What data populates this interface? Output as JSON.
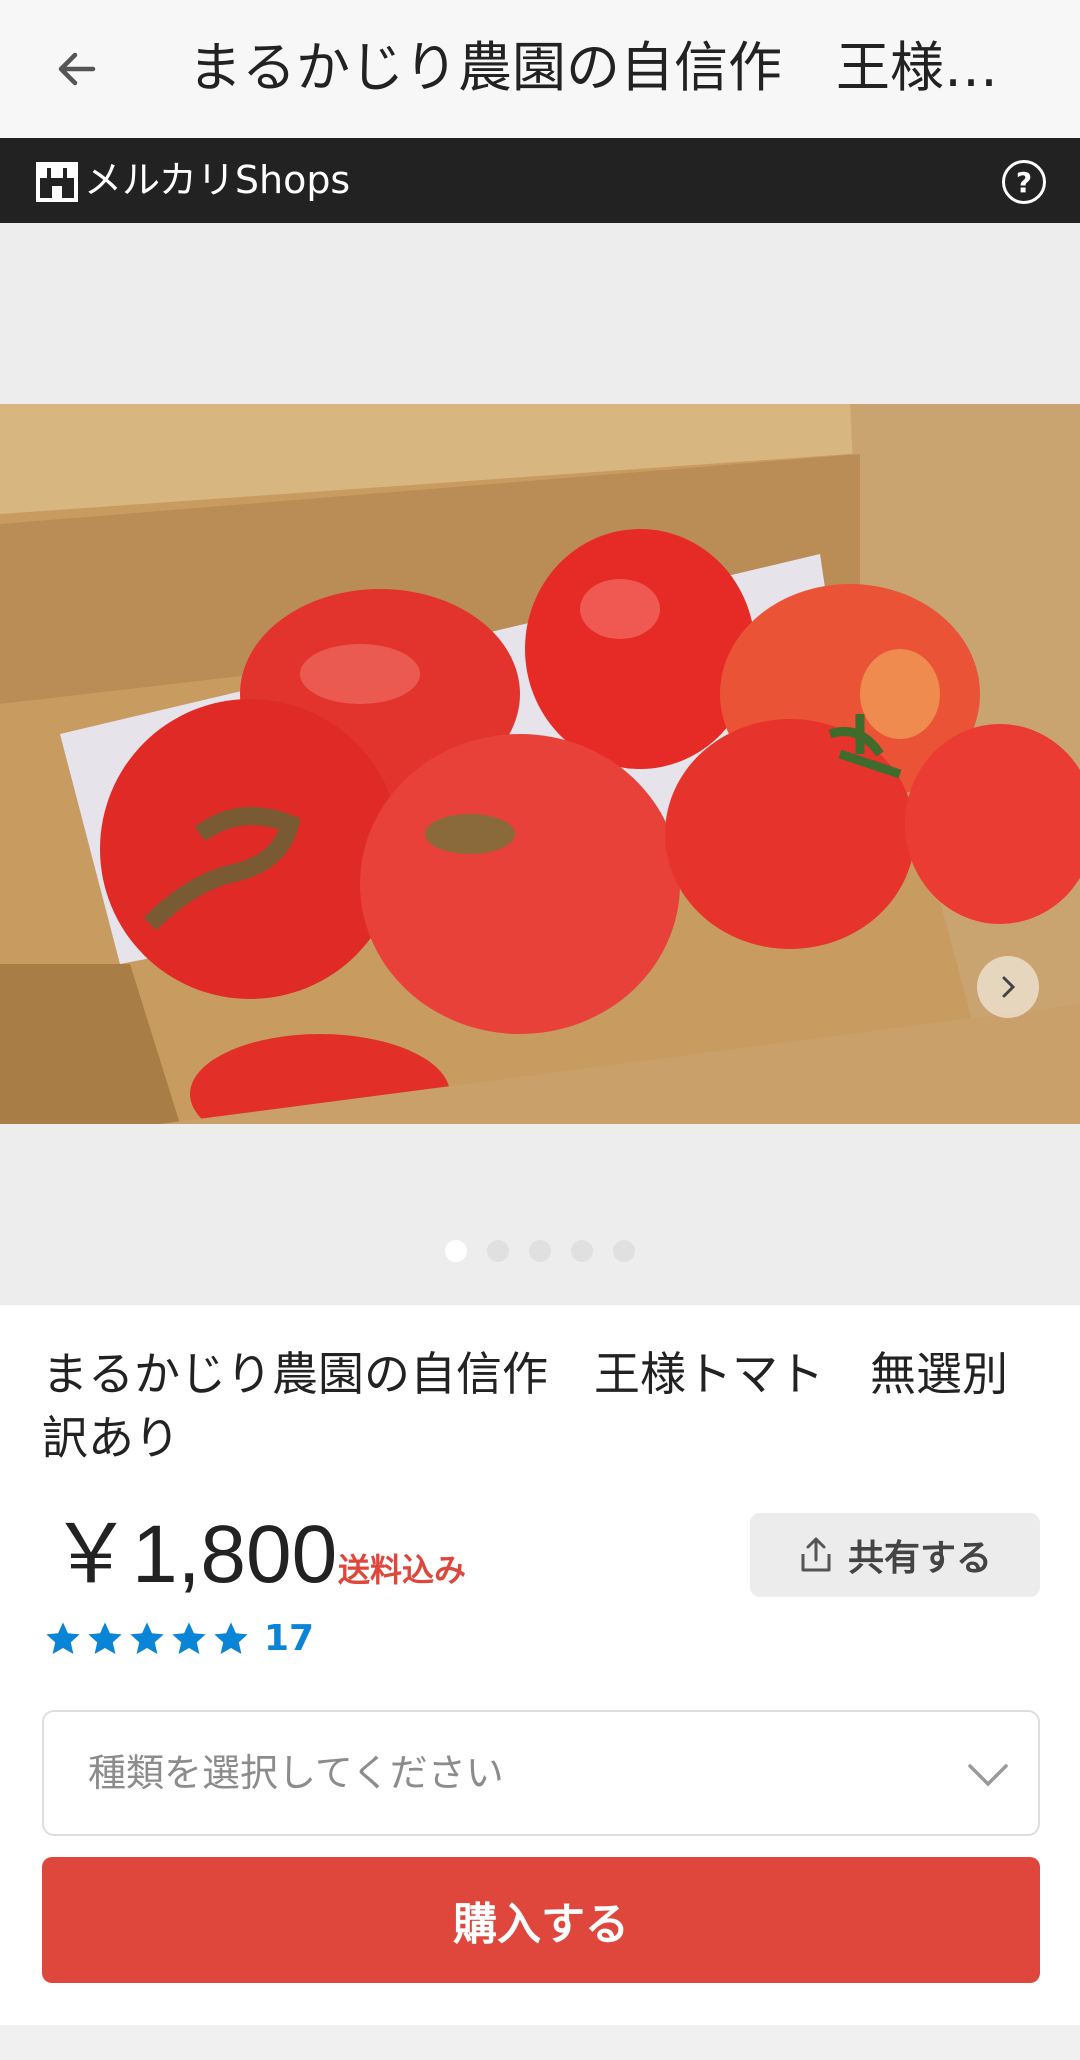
{
  "header": {
    "title": "まるかじり農園の自信作　王様…"
  },
  "shops_bar": {
    "label": "メルカリShops",
    "help": "?"
  },
  "gallery": {
    "image_count": 5,
    "active_index": 0
  },
  "product": {
    "title": "まるかじり農園の自信作　王様トマト　無選別訳あり",
    "price": "￥1,800",
    "shipping": "送料込み",
    "rating_stars": 5,
    "review_count": "17",
    "share_label": "共有する",
    "variant_placeholder": "種類を選択してください",
    "buy_label": "購入する"
  },
  "colors": {
    "accent_red": "#e0473c",
    "rating_blue": "#0a84d6",
    "bar_dark": "#222222"
  }
}
